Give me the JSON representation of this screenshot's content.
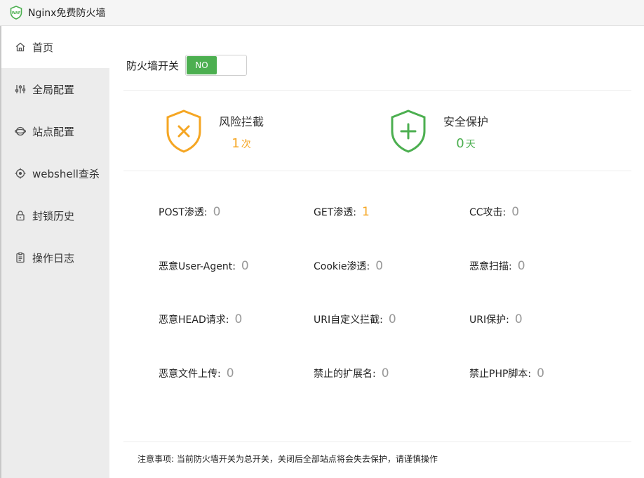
{
  "window": {
    "title": "Nginx免费防火墙",
    "logo_text": "WAF"
  },
  "sidebar": {
    "items": [
      {
        "label": "首页",
        "icon": "home-icon"
      },
      {
        "label": "全局配置",
        "icon": "sliders-icon"
      },
      {
        "label": "站点配置",
        "icon": "globe-icon"
      },
      {
        "label": "webshell查杀",
        "icon": "target-icon"
      },
      {
        "label": "封锁历史",
        "icon": "lock-icon"
      },
      {
        "label": "操作日志",
        "icon": "clipboard-icon"
      }
    ]
  },
  "firewall": {
    "switch_label": "防火墙开关",
    "toggle_text": "NO"
  },
  "summary": {
    "risk": {
      "label": "风险拦截",
      "value": "1",
      "unit": "次",
      "color": "#f5a623"
    },
    "safe": {
      "label": "安全保护",
      "value": "0",
      "unit": "天",
      "color": "#4caf50"
    }
  },
  "stats": [
    {
      "label": "POST渗透:",
      "value": "0"
    },
    {
      "label": "GET渗透:",
      "value": "1"
    },
    {
      "label": "CC攻击:",
      "value": "0"
    },
    {
      "label": "恶意User-Agent:",
      "value": "0"
    },
    {
      "label": "Cookie渗透:",
      "value": "0"
    },
    {
      "label": "恶意扫描:",
      "value": "0"
    },
    {
      "label": "恶意HEAD请求:",
      "value": "0"
    },
    {
      "label": "URI自定义拦截:",
      "value": "0"
    },
    {
      "label": "URI保护:",
      "value": "0"
    },
    {
      "label": "恶意文件上传:",
      "value": "0"
    },
    {
      "label": "禁止的扩展名:",
      "value": "0"
    },
    {
      "label": "禁止PHP脚本:",
      "value": "0"
    }
  ],
  "notice": "注意事项: 当前防火墙开关为总开关，关闭后全部站点将会失去保护，请谨慎操作"
}
